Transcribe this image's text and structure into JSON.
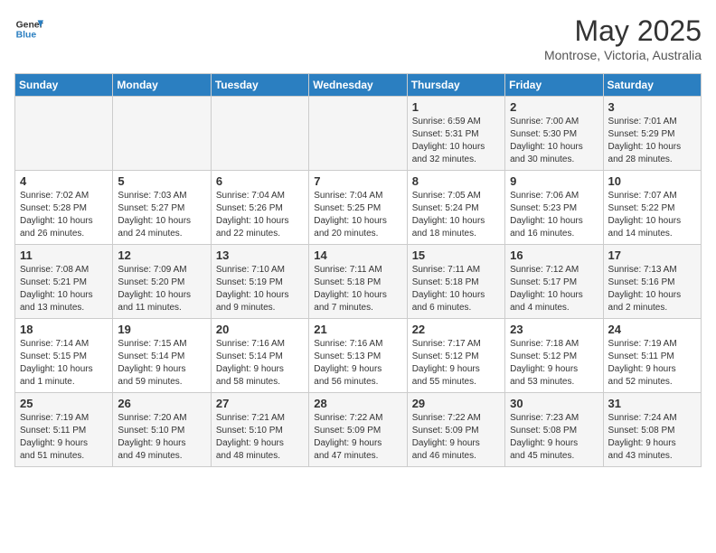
{
  "header": {
    "logo_line1": "General",
    "logo_line2": "Blue",
    "title": "May 2025",
    "subtitle": "Montrose, Victoria, Australia"
  },
  "days_of_week": [
    "Sunday",
    "Monday",
    "Tuesday",
    "Wednesday",
    "Thursday",
    "Friday",
    "Saturday"
  ],
  "weeks": [
    [
      {
        "day": "",
        "info": ""
      },
      {
        "day": "",
        "info": ""
      },
      {
        "day": "",
        "info": ""
      },
      {
        "day": "",
        "info": ""
      },
      {
        "day": "1",
        "info": "Sunrise: 6:59 AM\nSunset: 5:31 PM\nDaylight: 10 hours\nand 32 minutes."
      },
      {
        "day": "2",
        "info": "Sunrise: 7:00 AM\nSunset: 5:30 PM\nDaylight: 10 hours\nand 30 minutes."
      },
      {
        "day": "3",
        "info": "Sunrise: 7:01 AM\nSunset: 5:29 PM\nDaylight: 10 hours\nand 28 minutes."
      }
    ],
    [
      {
        "day": "4",
        "info": "Sunrise: 7:02 AM\nSunset: 5:28 PM\nDaylight: 10 hours\nand 26 minutes."
      },
      {
        "day": "5",
        "info": "Sunrise: 7:03 AM\nSunset: 5:27 PM\nDaylight: 10 hours\nand 24 minutes."
      },
      {
        "day": "6",
        "info": "Sunrise: 7:04 AM\nSunset: 5:26 PM\nDaylight: 10 hours\nand 22 minutes."
      },
      {
        "day": "7",
        "info": "Sunrise: 7:04 AM\nSunset: 5:25 PM\nDaylight: 10 hours\nand 20 minutes."
      },
      {
        "day": "8",
        "info": "Sunrise: 7:05 AM\nSunset: 5:24 PM\nDaylight: 10 hours\nand 18 minutes."
      },
      {
        "day": "9",
        "info": "Sunrise: 7:06 AM\nSunset: 5:23 PM\nDaylight: 10 hours\nand 16 minutes."
      },
      {
        "day": "10",
        "info": "Sunrise: 7:07 AM\nSunset: 5:22 PM\nDaylight: 10 hours\nand 14 minutes."
      }
    ],
    [
      {
        "day": "11",
        "info": "Sunrise: 7:08 AM\nSunset: 5:21 PM\nDaylight: 10 hours\nand 13 minutes."
      },
      {
        "day": "12",
        "info": "Sunrise: 7:09 AM\nSunset: 5:20 PM\nDaylight: 10 hours\nand 11 minutes."
      },
      {
        "day": "13",
        "info": "Sunrise: 7:10 AM\nSunset: 5:19 PM\nDaylight: 10 hours\nand 9 minutes."
      },
      {
        "day": "14",
        "info": "Sunrise: 7:11 AM\nSunset: 5:18 PM\nDaylight: 10 hours\nand 7 minutes."
      },
      {
        "day": "15",
        "info": "Sunrise: 7:11 AM\nSunset: 5:18 PM\nDaylight: 10 hours\nand 6 minutes."
      },
      {
        "day": "16",
        "info": "Sunrise: 7:12 AM\nSunset: 5:17 PM\nDaylight: 10 hours\nand 4 minutes."
      },
      {
        "day": "17",
        "info": "Sunrise: 7:13 AM\nSunset: 5:16 PM\nDaylight: 10 hours\nand 2 minutes."
      }
    ],
    [
      {
        "day": "18",
        "info": "Sunrise: 7:14 AM\nSunset: 5:15 PM\nDaylight: 10 hours\nand 1 minute."
      },
      {
        "day": "19",
        "info": "Sunrise: 7:15 AM\nSunset: 5:14 PM\nDaylight: 9 hours\nand 59 minutes."
      },
      {
        "day": "20",
        "info": "Sunrise: 7:16 AM\nSunset: 5:14 PM\nDaylight: 9 hours\nand 58 minutes."
      },
      {
        "day": "21",
        "info": "Sunrise: 7:16 AM\nSunset: 5:13 PM\nDaylight: 9 hours\nand 56 minutes."
      },
      {
        "day": "22",
        "info": "Sunrise: 7:17 AM\nSunset: 5:12 PM\nDaylight: 9 hours\nand 55 minutes."
      },
      {
        "day": "23",
        "info": "Sunrise: 7:18 AM\nSunset: 5:12 PM\nDaylight: 9 hours\nand 53 minutes."
      },
      {
        "day": "24",
        "info": "Sunrise: 7:19 AM\nSunset: 5:11 PM\nDaylight: 9 hours\nand 52 minutes."
      }
    ],
    [
      {
        "day": "25",
        "info": "Sunrise: 7:19 AM\nSunset: 5:11 PM\nDaylight: 9 hours\nand 51 minutes."
      },
      {
        "day": "26",
        "info": "Sunrise: 7:20 AM\nSunset: 5:10 PM\nDaylight: 9 hours\nand 49 minutes."
      },
      {
        "day": "27",
        "info": "Sunrise: 7:21 AM\nSunset: 5:10 PM\nDaylight: 9 hours\nand 48 minutes."
      },
      {
        "day": "28",
        "info": "Sunrise: 7:22 AM\nSunset: 5:09 PM\nDaylight: 9 hours\nand 47 minutes."
      },
      {
        "day": "29",
        "info": "Sunrise: 7:22 AM\nSunset: 5:09 PM\nDaylight: 9 hours\nand 46 minutes."
      },
      {
        "day": "30",
        "info": "Sunrise: 7:23 AM\nSunset: 5:08 PM\nDaylight: 9 hours\nand 45 minutes."
      },
      {
        "day": "31",
        "info": "Sunrise: 7:24 AM\nSunset: 5:08 PM\nDaylight: 9 hours\nand 43 minutes."
      }
    ]
  ]
}
